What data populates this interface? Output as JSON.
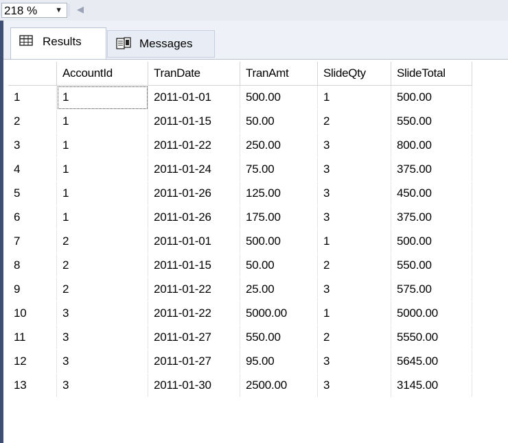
{
  "zoom": {
    "value": "218 %",
    "dropdown_icon": "chevron-down-icon"
  },
  "tabs": [
    {
      "label": "Results",
      "icon": "grid-icon",
      "selected": true
    },
    {
      "label": "Messages",
      "icon": "messages-icon",
      "selected": false
    }
  ],
  "results": {
    "columns": [
      "AccountId",
      "TranDate",
      "TranAmt",
      "SlideQty",
      "SlideTotal"
    ],
    "rows": [
      {
        "n": "1",
        "cells": [
          "1",
          "2011-01-01",
          "500.00",
          "1",
          "500.00"
        ]
      },
      {
        "n": "2",
        "cells": [
          "1",
          "2011-01-15",
          "50.00",
          "2",
          "550.00"
        ]
      },
      {
        "n": "3",
        "cells": [
          "1",
          "2011-01-22",
          "250.00",
          "3",
          "800.00"
        ]
      },
      {
        "n": "4",
        "cells": [
          "1",
          "2011-01-24",
          "75.00",
          "3",
          "375.00"
        ]
      },
      {
        "n": "5",
        "cells": [
          "1",
          "2011-01-26",
          "125.00",
          "3",
          "450.00"
        ]
      },
      {
        "n": "6",
        "cells": [
          "1",
          "2011-01-26",
          "175.00",
          "3",
          "375.00"
        ]
      },
      {
        "n": "7",
        "cells": [
          "2",
          "2011-01-01",
          "500.00",
          "1",
          "500.00"
        ]
      },
      {
        "n": "8",
        "cells": [
          "2",
          "2011-01-15",
          "50.00",
          "2",
          "550.00"
        ]
      },
      {
        "n": "9",
        "cells": [
          "2",
          "2011-01-22",
          "25.00",
          "3",
          "575.00"
        ]
      },
      {
        "n": "10",
        "cells": [
          "3",
          "2011-01-22",
          "5000.00",
          "1",
          "5000.00"
        ]
      },
      {
        "n": "11",
        "cells": [
          "3",
          "2011-01-27",
          "550.00",
          "2",
          "5550.00"
        ]
      },
      {
        "n": "12",
        "cells": [
          "3",
          "2011-01-27",
          "95.00",
          "3",
          "5645.00"
        ]
      },
      {
        "n": "13",
        "cells": [
          "3",
          "2011-01-30",
          "2500.00",
          "3",
          "3145.00"
        ]
      }
    ]
  }
}
